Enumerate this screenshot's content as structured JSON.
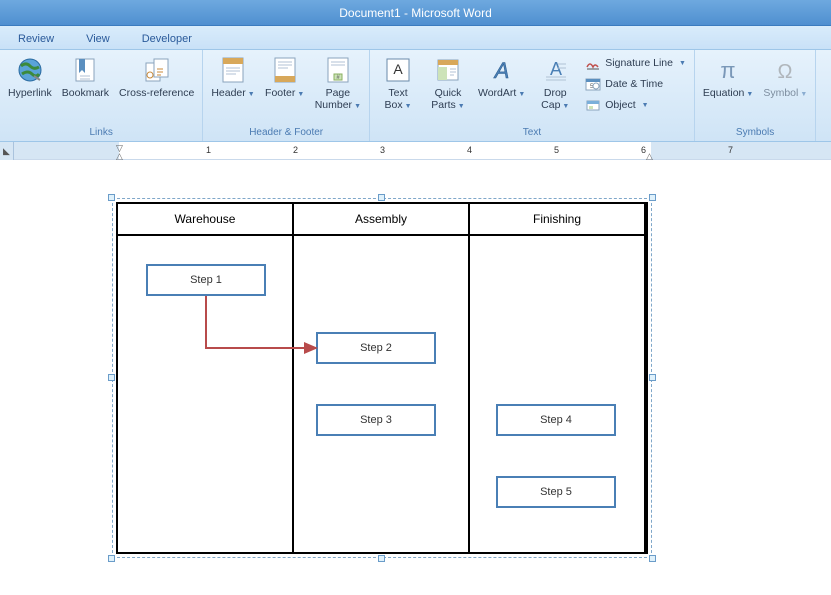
{
  "title": "Document1 - Microsoft Word",
  "tabs": {
    "review": "Review",
    "view": "View",
    "developer": "Developer"
  },
  "ribbon": {
    "links": {
      "hyperlink": "Hyperlink",
      "bookmark": "Bookmark",
      "crossref": "Cross-reference",
      "group": "Links"
    },
    "hf": {
      "header": "Header",
      "footer": "Footer",
      "pagenum": "Page\nNumber",
      "group": "Header & Footer"
    },
    "text": {
      "textbox": "Text\nBox",
      "quickparts": "Quick\nParts",
      "wordart": "WordArt",
      "dropcap": "Drop\nCap",
      "sigline": "Signature Line",
      "datetime": "Date & Time",
      "object": "Object",
      "group": "Text"
    },
    "symbols": {
      "equation": "Equation",
      "symbol": "Symbol",
      "group": "Symbols"
    }
  },
  "ruler": {
    "marks": [
      "1",
      "2",
      "3",
      "4",
      "5",
      "6",
      "7"
    ]
  },
  "diagram": {
    "lanes": [
      "Warehouse",
      "Assembly",
      "Finishing"
    ],
    "steps": {
      "s1": "Step 1",
      "s2": "Step 2",
      "s3": "Step 3",
      "s4": "Step 4",
      "s5": "Step 5"
    }
  }
}
